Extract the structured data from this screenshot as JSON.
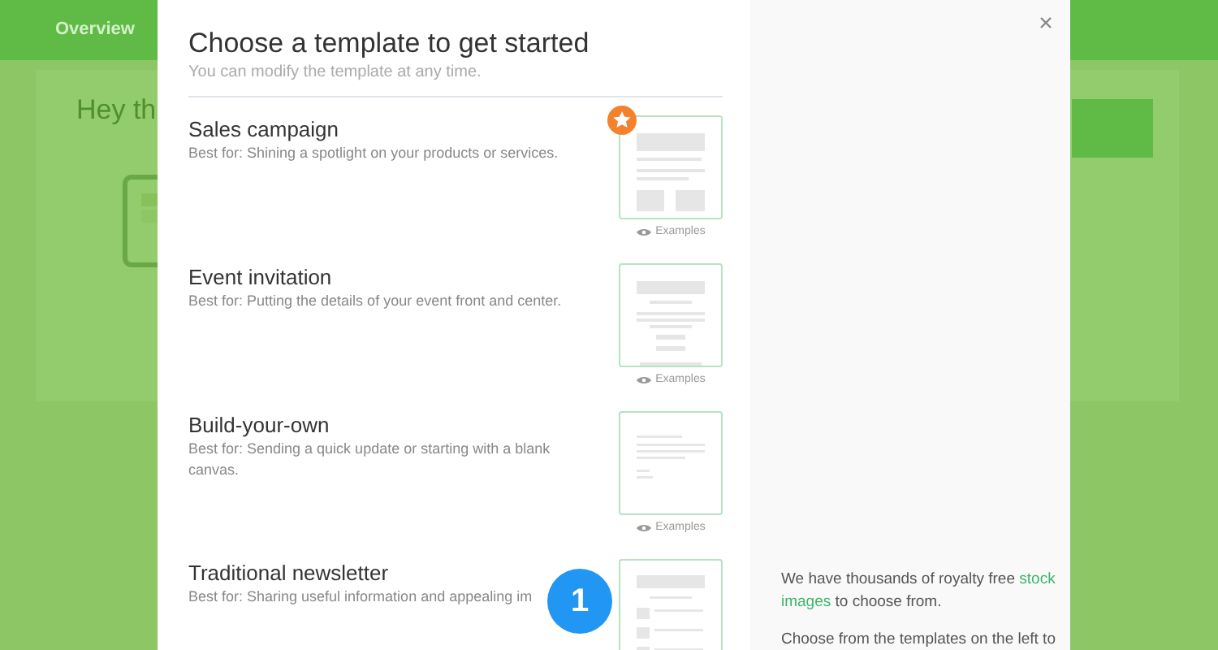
{
  "background": {
    "tabs": [
      {
        "label": "Overview"
      }
    ],
    "greeting": "Hey th"
  },
  "modal": {
    "title": "Choose a template to get started",
    "subtitle": "You can modify the template at any time.",
    "templates": [
      {
        "title": "Sales campaign",
        "description": "Best for: Shining a spotlight on your products or services.",
        "featured": true,
        "examples": "Examples",
        "kind": "sales"
      },
      {
        "title": "Event invitation",
        "description": "Best for: Putting the details of your event front and center.",
        "featured": false,
        "examples": "Examples",
        "kind": "event"
      },
      {
        "title": "Build-your-own",
        "description": "Best for: Sending a quick update or starting with a blank canvas.",
        "featured": false,
        "examples": "Examples",
        "kind": "blank"
      },
      {
        "title": "Traditional newsletter",
        "description": "Best for: Sharing useful information and appealing im",
        "featured": false,
        "kind": "newsletter"
      }
    ],
    "info": [
      "We have thousands of royalty free **stock images** to choose from.",
      "Choose from the templates on the left to"
    ]
  },
  "step_badge": "1"
}
